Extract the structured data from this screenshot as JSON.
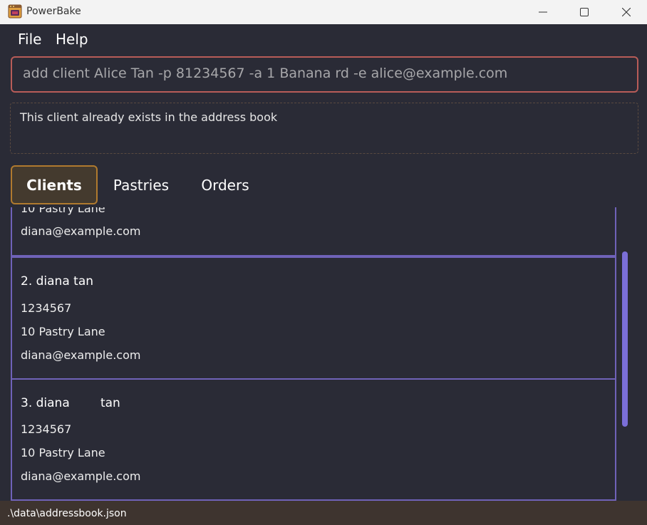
{
  "window": {
    "title": "PowerBake",
    "app_icon": "oven-icon",
    "controls": [
      "minimize-icon",
      "maximize-icon",
      "close-icon"
    ]
  },
  "menu": {
    "file": "File",
    "help": "Help"
  },
  "command": {
    "value": "add client Alice Tan -p 81234567 -a 1 Banana rd -e alice@example.com"
  },
  "result": {
    "message": "This client already exists in the address book"
  },
  "tabs": [
    {
      "label": "Clients",
      "active": true
    },
    {
      "label": "Pastries",
      "active": false
    },
    {
      "label": "Orders",
      "active": false
    }
  ],
  "clients": [
    {
      "name": "",
      "phone": "",
      "address": "10 Pastry Lane",
      "email": "diana@example.com"
    },
    {
      "name": "2. diana tan",
      "phone": "1234567",
      "address": "10 Pastry Lane",
      "email": "diana@example.com"
    },
    {
      "name": "3. diana        tan",
      "phone": "1234567",
      "address": "10 Pastry Lane",
      "email": "diana@example.com"
    }
  ],
  "status": {
    "path": ".\\data\\addressbook.json"
  },
  "colors": {
    "background": "#2a2b36",
    "command_border": "#b85c58",
    "tab_active_border": "#b07a2e",
    "card_border": "#6f62b8",
    "scroll_thumb": "#7b6fd8",
    "statusbar": "#3e342f"
  }
}
